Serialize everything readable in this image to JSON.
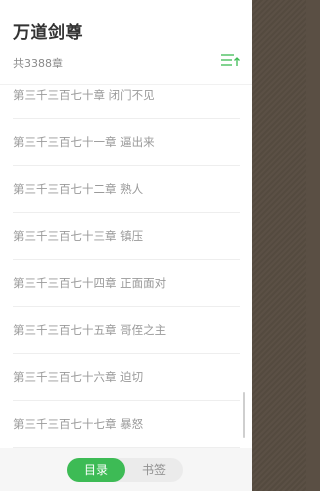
{
  "book": {
    "title": "万道剑尊",
    "chapter_count": "共3388章"
  },
  "chapters": [
    "第三千三百七十章 闭门不见",
    "第三千三百七十一章 逼出来",
    "第三千三百七十二章 熟人",
    "第三千三百七十三章 镇压",
    "第三千三百七十四章 正面面对",
    "第三千三百七十五章 哥侄之主",
    "第三千三百七十六章 迫切",
    "第三千三百七十七章 暴怒"
  ],
  "tabs": {
    "toc": "目录",
    "bookmarks": "书签"
  },
  "colors": {
    "accent": "#3dbb55",
    "backdrop": "#5a4f44"
  },
  "icons": {
    "sort": "sort-order-icon"
  }
}
